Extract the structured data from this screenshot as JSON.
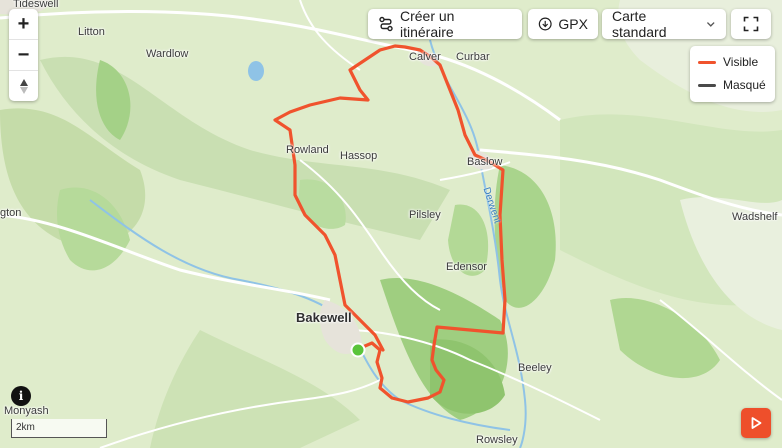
{
  "toolbar": {
    "create_route_label": "Créer un itinéraire",
    "gpx_label": "GPX",
    "map_style_selected": "Carte standard"
  },
  "zoom": {
    "in_label": "+",
    "out_label": "−"
  },
  "legend": {
    "visible_label": "Visible",
    "visible_color": "#f0532d",
    "hidden_label": "Masqué",
    "hidden_color": "#4a4a4a"
  },
  "places": {
    "tideswell": "Tideswell",
    "litton": "Litton",
    "wardlow": "Wardlow",
    "calver": "Calver",
    "curbar": "Curbar",
    "rowland": "Rowland",
    "hassop": "Hassop",
    "baslow": "Baslow",
    "pilsley": "Pilsley",
    "edensor": "Edensor",
    "wadshelf": "Wadshelf",
    "ashford": "gton",
    "bakewell": "Bakewell",
    "beeley": "Beeley",
    "monyash": "Monyash",
    "rowsley": "Rowsley"
  },
  "river": {
    "derwent": "Derwent"
  },
  "scale_label": "2km",
  "info_label": "i",
  "colors": {
    "route": "#f0532d",
    "start_marker": "#5ac43a",
    "map_base": "#dfeccb",
    "forest": "#a9d48c",
    "water": "#8fc3e6",
    "road": "#ffffff"
  }
}
